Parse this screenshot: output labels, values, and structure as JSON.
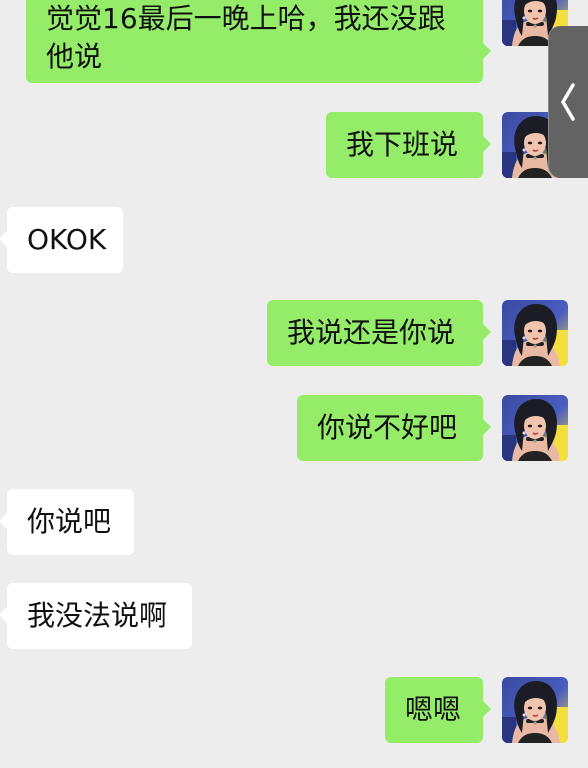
{
  "messages": [
    {
      "side": "out",
      "text_line1": "觉觉16最后一晚上哈，我还没跟",
      "text_line2": "他说"
    },
    {
      "side": "out",
      "text": "我下班说"
    },
    {
      "side": "in",
      "text": "OKOK"
    },
    {
      "side": "out",
      "text": "我说还是你说"
    },
    {
      "side": "out",
      "text": "你说不好吧"
    },
    {
      "side": "in",
      "text": "你说吧"
    },
    {
      "side": "in",
      "text": "我没法说啊"
    },
    {
      "side": "out",
      "text": "嗯嗯"
    }
  ],
  "colors": {
    "background": "#ededed",
    "outgoing_bubble": "#95ec69",
    "incoming_bubble": "#ffffff",
    "handle": "#636363"
  },
  "icons": {
    "avatar": "avatar-illustrated-woman",
    "handle": "chevron-left-icon"
  }
}
